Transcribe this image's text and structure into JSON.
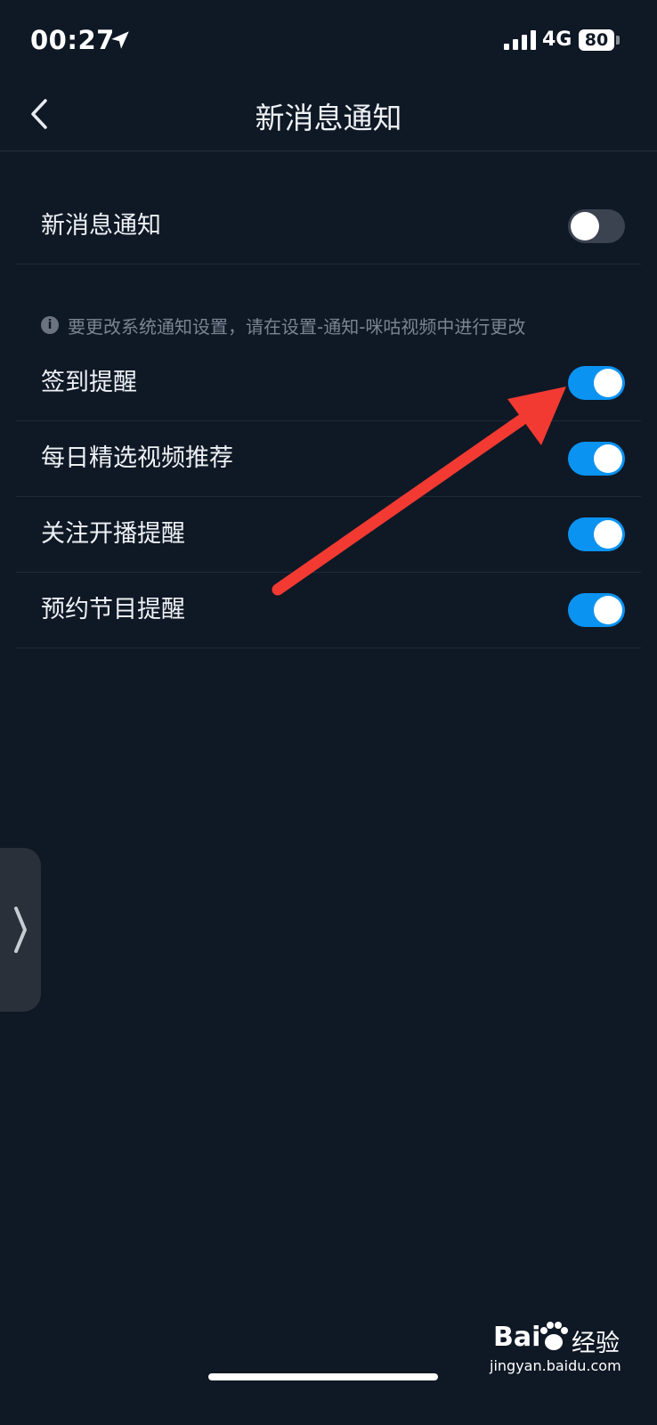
{
  "status_bar": {
    "time": "00:27",
    "network": "4G",
    "battery": "80"
  },
  "nav": {
    "title": "新消息通知"
  },
  "main_toggle": {
    "label": "新消息通知",
    "enabled": false
  },
  "hint": {
    "text": "要更改系统通知设置，请在设置-通知-咪咕视频中进行更改"
  },
  "settings": [
    {
      "label": "签到提醒",
      "enabled": true
    },
    {
      "label": "每日精选视频推荐",
      "enabled": true
    },
    {
      "label": "关注开播提醒",
      "enabled": true
    },
    {
      "label": "预约节目提醒",
      "enabled": true
    }
  ],
  "watermark": {
    "brand": "Bai",
    "brand_suffix": "经验",
    "url": "jingyan.baidu.com"
  },
  "colors": {
    "background": "#0f1825",
    "toggle_on": "#0b93f2",
    "toggle_off": "#3b4350",
    "annotation_arrow": "#f23a32"
  }
}
